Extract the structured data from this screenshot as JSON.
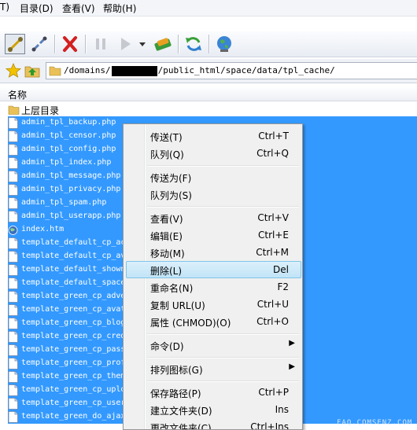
{
  "menubar": {
    "items": [
      "T)",
      "目录(D)",
      "查看(V)",
      "帮助(H)"
    ]
  },
  "toolbar": {
    "buttons": [
      {
        "name": "connect-icon",
        "state": "pressed"
      },
      {
        "name": "disconnect-icon"
      },
      {
        "name": "stop-icon"
      },
      {
        "name": "pause-icon",
        "state": "disabled"
      },
      {
        "name": "play-icon",
        "state": "disabled"
      },
      {
        "name": "transfer-mode-icon"
      },
      {
        "name": "refresh-icon"
      },
      {
        "name": "globe-icon"
      }
    ]
  },
  "pathbar": {
    "path_prefix": "/domains/",
    "path_suffix": "/public_html/space/data/tpl_cache/"
  },
  "columns": {
    "name": "名称"
  },
  "files": {
    "parent": "上层目录",
    "items": [
      "admin_tpl_backup.php",
      "admin_tpl_censor.php",
      "admin_tpl_config.php",
      "admin_tpl_index.php",
      "admin_tpl_message.php",
      "admin_tpl_privacy.php",
      "admin_tpl_spam.php",
      "admin_tpl_userapp.php",
      "index.htm",
      "template_default_cp_ac",
      "template_default_cp_av",
      "template_default_shown",
      "template_default_space",
      "template_green_cp_adve",
      "template_green_cp_avat",
      "template_green_cp_blog",
      "template_green_cp_cred",
      "template_green_cp_pass",
      "template_green_cp_prof",
      "template_green_cp_them",
      "template_green_cp_uplo",
      "template_green_cp_user",
      "template_green_do_ajax"
    ]
  },
  "context_menu": {
    "groups": [
      [
        {
          "label": "传送(T)",
          "key": "Ctrl+T"
        },
        {
          "label": "队列(Q)",
          "key": "Ctrl+Q"
        }
      ],
      [
        {
          "label": "传送为(F)",
          "key": ""
        },
        {
          "label": "队列为(S)",
          "key": ""
        }
      ],
      [
        {
          "label": "查看(V)",
          "key": "Ctrl+V"
        },
        {
          "label": "编辑(E)",
          "key": "Ctrl+E"
        },
        {
          "label": "移动(M)",
          "key": "Ctrl+M"
        },
        {
          "label": "删除(L)",
          "key": "Del",
          "highlighted": true
        },
        {
          "label": "重命名(N)",
          "key": "F2"
        },
        {
          "label": "复制 URL(U)",
          "key": "Ctrl+U"
        },
        {
          "label": "属性 (CHMOD)(O)",
          "key": "Ctrl+O"
        }
      ],
      [
        {
          "label": "命令(D)",
          "key": "",
          "submenu": true
        }
      ],
      [
        {
          "label": "排列图标(G)",
          "key": "",
          "submenu": true
        }
      ],
      [
        {
          "label": "保存路径(P)",
          "key": "Ctrl+P"
        },
        {
          "label": "建立文件夹(D)",
          "key": "Ins"
        },
        {
          "label": "更改文件夹(C)",
          "key": "Ctrl+Ins"
        }
      ]
    ]
  },
  "watermark": "FAQ.COMSENZ.COM",
  "colors": {
    "selection": "#3399ff",
    "menu_highlight": "#c1e4f7"
  }
}
